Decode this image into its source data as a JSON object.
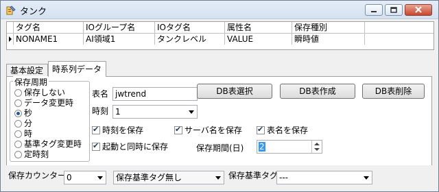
{
  "window": {
    "title": "タンク"
  },
  "grid": {
    "columns": [
      "タグ名",
      "IOグループ名",
      "IOタグ名",
      "属性名",
      "保存種別"
    ],
    "rows": [
      [
        "NONAME1",
        "AI領域1",
        "タンクレベル",
        "VALUE",
        "瞬時値"
      ]
    ]
  },
  "tabs": [
    {
      "label": "基本設定",
      "active": false
    },
    {
      "label": "時系列データ",
      "active": true
    }
  ],
  "period_group": {
    "label": "保存周期",
    "options": [
      {
        "label": "保存しない",
        "selected": false
      },
      {
        "label": "データ変更時",
        "selected": false
      },
      {
        "label": "秒",
        "selected": true
      },
      {
        "label": "分",
        "selected": false
      },
      {
        "label": "時",
        "selected": false
      },
      {
        "label": "基準タグ変更時",
        "selected": false
      },
      {
        "label": "定時刻",
        "selected": false
      }
    ]
  },
  "form": {
    "table_name_label": "表名",
    "table_name_value": "jwtrend",
    "time_label": "時刻",
    "time_value": "1",
    "db_select_button": "DB表選択",
    "db_create_button": "DB表作成",
    "db_delete_button": "DB表削除",
    "save_time_label": "時刻を保存",
    "save_time_checked": true,
    "save_server_label": "サーバ名を保存",
    "save_server_checked": true,
    "save_table_label": "表名を保存",
    "save_table_checked": true,
    "save_on_start_label": "起動と同時に保存",
    "save_on_start_checked": true,
    "retention_label": "保存期間(日)",
    "retention_value": "2"
  },
  "bottom": {
    "counter_label": "保存カウンター",
    "counter_value": "0",
    "base_tag_mode_value": "保存基準タグ無し",
    "base_tag_label": "保存基準タグ",
    "base_tag_value": "---"
  },
  "colors": {
    "title_gradient_top": "#e4edf7",
    "title_gradient_bottom": "#d4e1ef",
    "close_button": "#c9462c",
    "radio_dot": "#1c5d99",
    "selection": "#3399ff"
  }
}
